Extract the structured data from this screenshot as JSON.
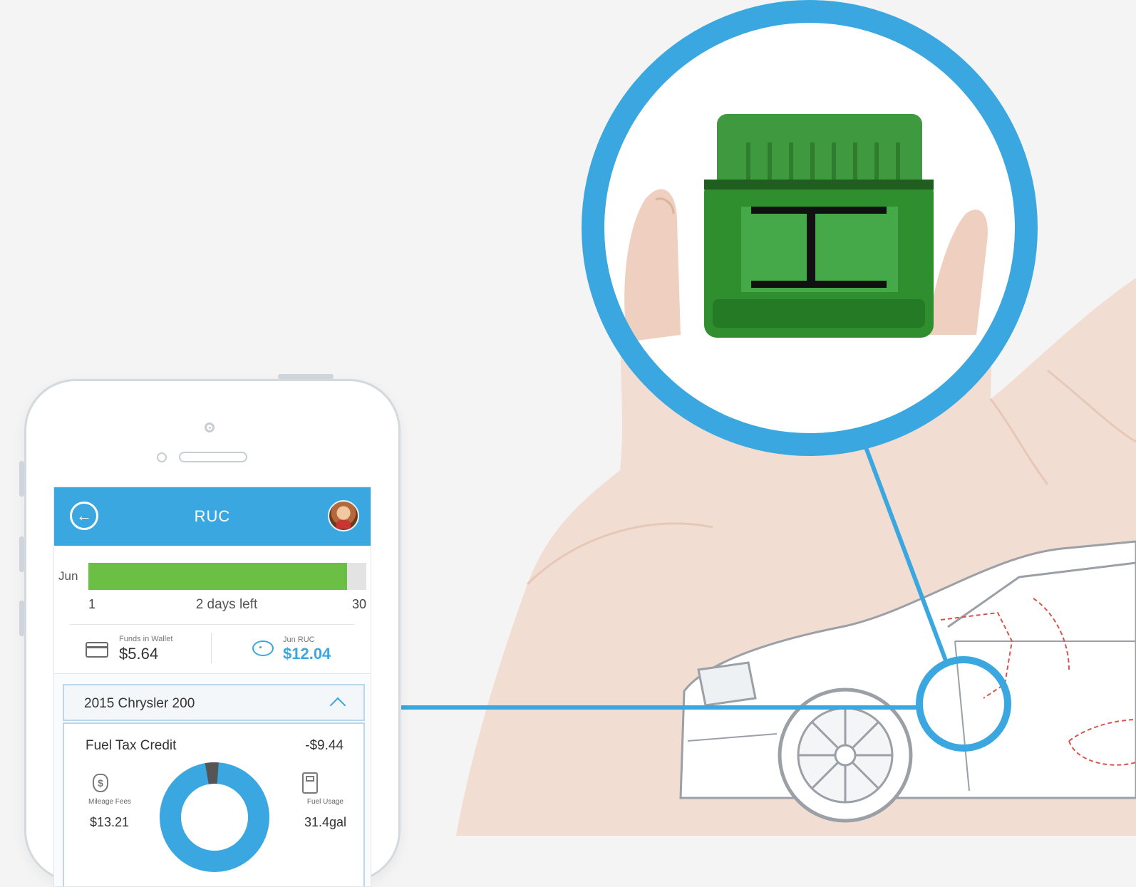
{
  "app": {
    "title": "RUC",
    "colors": {
      "brand": "#3aa7e0",
      "progress": "#6cbf45"
    }
  },
  "progress": {
    "month": "Jun",
    "start_day": "1",
    "end_day": "30",
    "status": "2 days left",
    "elapsed_fraction": 0.93
  },
  "stats": {
    "wallet_label": "Funds in Wallet",
    "wallet_value": "$5.64",
    "ruc_label": "Jun RUC",
    "ruc_value": "$12.04"
  },
  "vehicle": {
    "name": "2015 Chrysler 200",
    "credit_label": "Fuel Tax Credit",
    "credit_value": "-$9.44",
    "mileage_label": "Mileage Fees",
    "mileage_value": "$13.21",
    "fuel_label": "Fuel Usage",
    "fuel_value": "31.4gal",
    "donut_colors": {
      "main": "#3aa7e0",
      "slice": "#555555"
    },
    "donut_slice_fraction": 0.04
  },
  "icons": [
    "back-arrow-icon",
    "avatar",
    "wallet-icon",
    "piggy-bank-icon",
    "chevron-up-icon",
    "money-bag-icon",
    "fuel-pump-icon"
  ]
}
